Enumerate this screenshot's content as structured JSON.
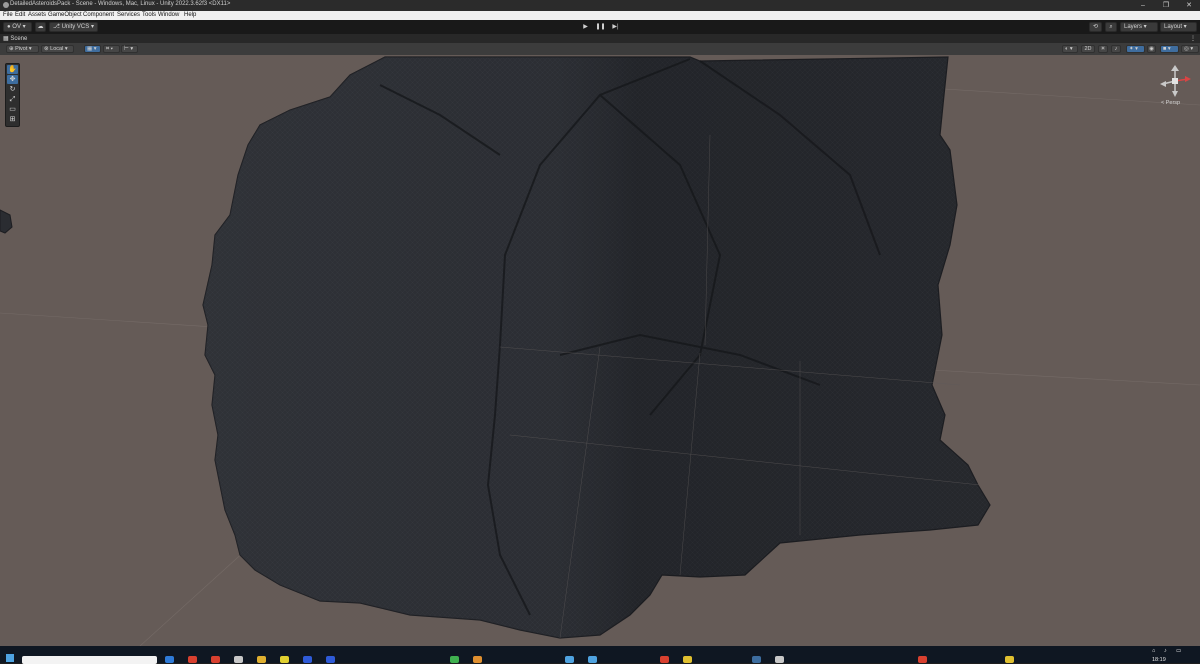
{
  "window": {
    "title": "DetailedAsteroidsPack - Scene - Windows, Mac, Linux - Unity 2022.3.62f3 <DX11>",
    "controls": [
      "–",
      "❐",
      "✕"
    ]
  },
  "menu": [
    "File",
    "Edit",
    "Assets",
    "GameObject",
    "Component",
    "Services",
    "Tools",
    "Window",
    "Help"
  ],
  "toolbar": {
    "account": "OV",
    "vcs": "Unity VCS",
    "layers": "Layers",
    "layout": "Layout"
  },
  "scene_tab": {
    "label": "Scene"
  },
  "scene_toolbar": {
    "pivot": "Pivot",
    "local": "Local",
    "mode_2d": "2D"
  },
  "gizmo": {
    "label": "< Persp"
  },
  "taskbar": {
    "time": "18:19"
  },
  "colors": {
    "viewport_bg": "#655b57",
    "active_tool": "#3d6d9f",
    "mesh": "#2a2c31"
  }
}
